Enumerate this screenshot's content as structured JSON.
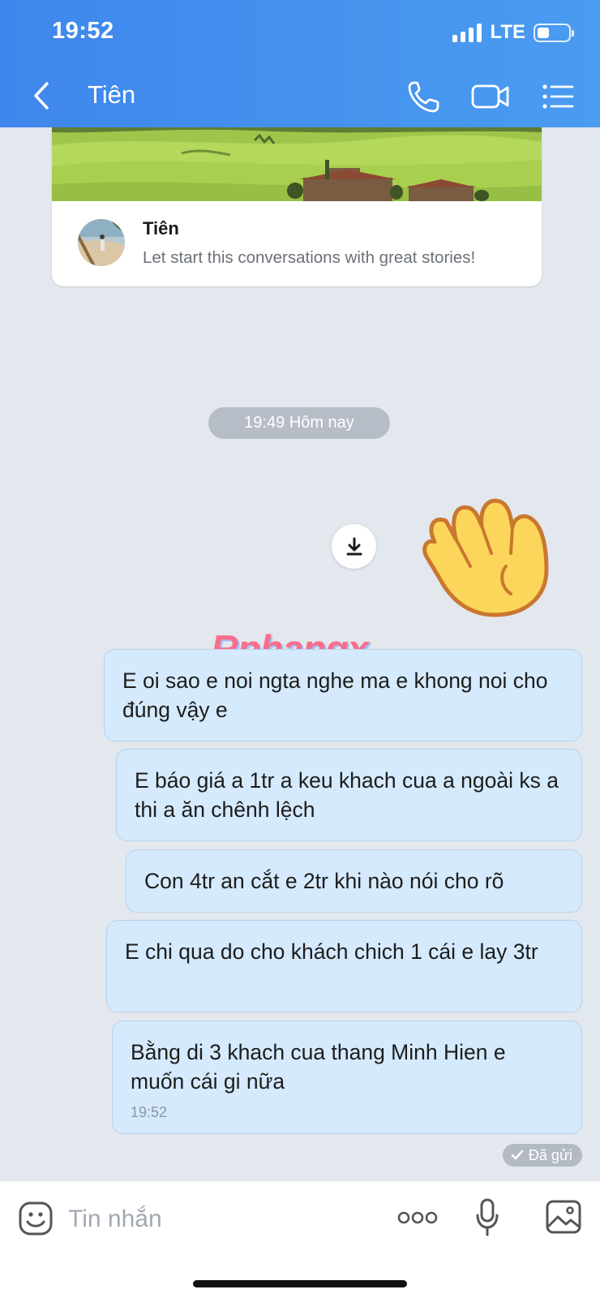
{
  "status_bar": {
    "time": "19:52",
    "network": "LTE",
    "battery_level": 0.4
  },
  "header": {
    "title": "Tiên",
    "icons": {
      "back": "chevron-left-icon",
      "call": "phone-icon",
      "video": "video-camera-icon",
      "menu": "list-menu-icon"
    },
    "color": "#3f86ec"
  },
  "story_card": {
    "name": "Tiên",
    "description": "Let start this conversations with great stories!"
  },
  "conversation": {
    "time_divider": "19:49 Hôm nay",
    "sticker": "waving-hand-sticker",
    "watermark": "Rphangx",
    "messages": [
      {
        "text": "E oi sao e noi ngta nghe ma e khong noi cho đúng vậy e"
      },
      {
        "text": "E báo giá a 1tr a keu khach cua a ngoài ks a thi a ăn chênh lệch"
      },
      {
        "text": "Con 4tr an cắt e 2tr khi nào nói cho rõ"
      },
      {
        "text": "E chi qua do cho khách chich 1 cái e lay 3tr"
      },
      {
        "text": "Bằng di 3 khach cua thang Minh Hien e muốn cái gi nữa",
        "time": "19:52"
      }
    ],
    "status": "Đã gửi",
    "bubble_color": "#d5eafc"
  },
  "composer": {
    "placeholder": "Tin nhắn",
    "icons": {
      "emoji": "emoji-face-icon",
      "more": "more-dots-icon",
      "voice": "microphone-icon",
      "image": "image-gallery-icon"
    }
  }
}
